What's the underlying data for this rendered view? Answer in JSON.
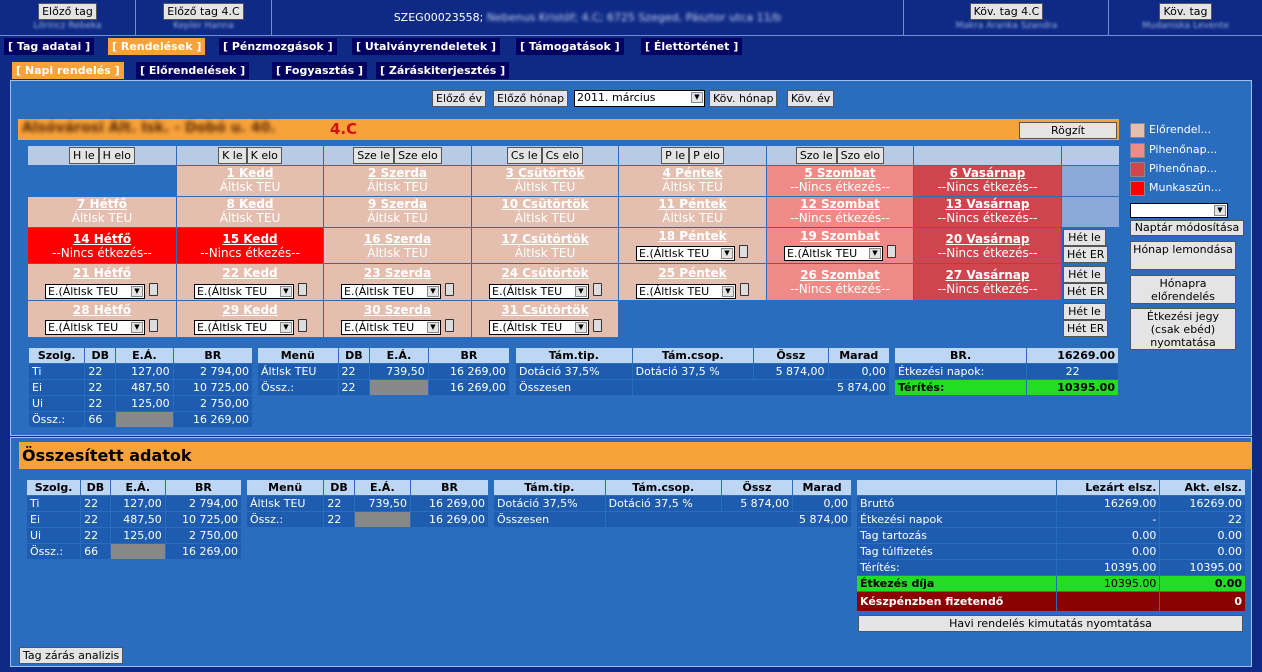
{
  "nav": {
    "prev_member": "Előző tag",
    "prev_member_name": "Lőrincz Rebeka",
    "prev_class": "Előző tag 4.C",
    "prev_class_name": "Kepler Hanna",
    "member_code": "SZEG00023558;",
    "member_info": "Nebenus Kristóf; 4.C; 6725 Szeged, Pásztor utca 11/b",
    "next_class": "Köv. tag 4.C",
    "next_class_name": "Makra Aranka Szandra",
    "next_member": "Köv. tag",
    "next_member_name": "Mudaniska Levente"
  },
  "tabs": [
    "[ Tag adatai ]",
    "[ Rendelések ]",
    "[ Pénzmozgások ]",
    "[ Utalványrendeletek ]",
    "[ Támogatások ]",
    "[ Élettörténet ]"
  ],
  "subtabs": [
    "[ Napi rendelés ]",
    "[ Előrendelések ]",
    "[ Fogyasztás ]",
    "[ Záráskiterjesztés ]"
  ],
  "period": {
    "prev_year": "Előző év",
    "prev_month": "Előző hónap",
    "month": "2011. március",
    "next_month": "Köv. hónap",
    "next_year": "Köv. év"
  },
  "school": {
    "name": "Alsóvárosi Ált. Isk. - Dobó u. 40.",
    "cls": "4.C",
    "save": "Rögzít"
  },
  "weekdays": [
    [
      "H le",
      "H elo"
    ],
    [
      "K le",
      "K elo"
    ],
    [
      "Sze le",
      "Sze elo"
    ],
    [
      "Cs le",
      "Cs elo"
    ],
    [
      "P le",
      "P elo"
    ],
    [
      "Szo le",
      "Szo elo"
    ]
  ],
  "days": {
    "d1": "1 Kedd",
    "d2": "2 Szerda",
    "d3": "3 Csütörtök",
    "d4": "4 Péntek",
    "d5": "5 Szombat",
    "d6": "6 Vasárnap",
    "d7": "7 Hétfő",
    "d8": "8 Kedd",
    "d9": "9 Szerda",
    "d10": "10 Csütörtök",
    "d11": "11 Péntek",
    "d12": "12 Szombat",
    "d13": "13 Vasárnap",
    "d14": "14 Hétfő",
    "d15": "15 Kedd",
    "d16": "16 Szerda",
    "d17": "17 Csütörtök",
    "d18": "18 Péntek",
    "d19": "19 Szombat",
    "d20": "20 Vasárnap",
    "d21": "21 Hétfő",
    "d22": "22 Kedd",
    "d23": "23 Szerda",
    "d24": "24 Csütörtök",
    "d25": "25 Péntek",
    "d26": "26 Szombat",
    "d27": "27 Vasárnap",
    "d28": "28 Hétfő",
    "d29": "29 Kedd",
    "d30": "30 Szerda",
    "d31": "31 Csütörtök"
  },
  "labels": {
    "alt": "ÁltIsk TEU",
    "none": "--Nincs étkezés--",
    "sel": "E.(ÁltIsk TEU",
    "het_le": "Hét le",
    "het_er": "Hét ER"
  },
  "legend": [
    "Előrendel...",
    "Pihenőnap...",
    "Pihenőnap...",
    "Munkaszün..."
  ],
  "side": {
    "calendar_mod": "Naptár módosítása",
    "month_cancel": "Hónap lemondása",
    "month_preorder": "Hónapra előrendelés",
    "print_ticket": "Étkezési jegy (csak ebéd) nyomtatása"
  },
  "t1": {
    "h": [
      "Szolg.",
      "DB",
      "E.Á.",
      "BR"
    ],
    "rows": [
      [
        "Ti",
        "22",
        "127,00",
        "2 794,00"
      ],
      [
        "Ei",
        "22",
        "487,50",
        "10 725,00"
      ],
      [
        "Ui",
        "22",
        "125,00",
        "2 750,00"
      ],
      [
        "Össz.:",
        "66",
        "",
        "16 269,00"
      ]
    ]
  },
  "t2": {
    "h": [
      "Menü",
      "DB",
      "E.Á.",
      "BR"
    ],
    "rows": [
      [
        "ÁltIsk TEU",
        "22",
        "739,50",
        "16 269,00"
      ],
      [
        "Össz.:",
        "22",
        "",
        "16 269,00"
      ]
    ]
  },
  "t3": {
    "h": [
      "Tám.tip.",
      "Tám.csop.",
      "Össz",
      "Marad"
    ],
    "rows": [
      [
        "Dotáció 37,5%",
        "Dotáció 37,5 %",
        "5 874,00",
        "0,00"
      ]
    ],
    "total_label": "Összesen",
    "total": "5 874,00"
  },
  "t4": {
    "h": [
      "BR.",
      "16269.00"
    ],
    "days_label": "Étkezési napok:",
    "days": "22",
    "pay_label": "Térítés:",
    "pay": "10395.00"
  },
  "summary_title": "Összesített adatok",
  "t8": {
    "h": [
      "",
      "Lezárt elsz.",
      "Akt. elsz."
    ],
    "rows": [
      [
        "Bruttó",
        "16269.00",
        "16269.00"
      ],
      [
        "Étkezési napok",
        "-",
        "22"
      ],
      [
        "Tag tartozás",
        "0.00",
        "0.00"
      ],
      [
        "Tag túlfizetés",
        "0.00",
        "0.00"
      ],
      [
        "Térítés:",
        "10395.00",
        "10395.00"
      ]
    ],
    "fee_label": "Étkezés díja",
    "fee1": "10395.00",
    "fee2": "0.00",
    "cash_label": "Készpénzben fizetendő",
    "cash": "0",
    "print": "Havi rendelés kimutatás nyomtatása"
  },
  "bottom_btn": "Tag zárás analizis",
  "colors": {
    "accent": "#f7a23b",
    "background": "#0e2a86",
    "panel": "#2a6dbf"
  }
}
